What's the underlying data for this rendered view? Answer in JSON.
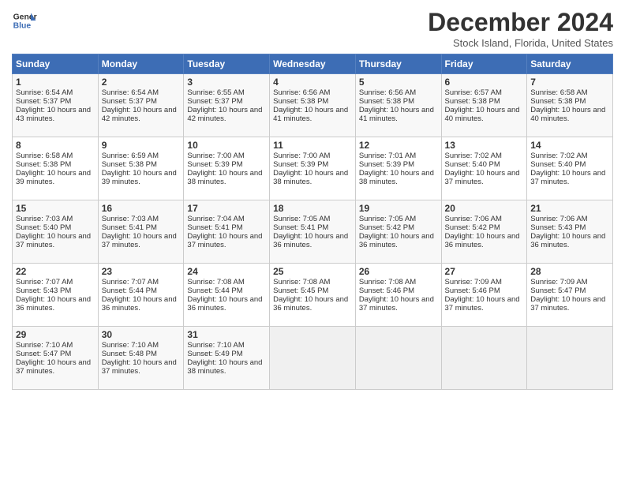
{
  "header": {
    "logo_line1": "General",
    "logo_line2": "Blue",
    "title": "December 2024",
    "subtitle": "Stock Island, Florida, United States"
  },
  "days_of_week": [
    "Sunday",
    "Monday",
    "Tuesday",
    "Wednesday",
    "Thursday",
    "Friday",
    "Saturday"
  ],
  "weeks": [
    [
      {
        "day": "1",
        "sunrise": "6:54 AM",
        "sunset": "5:37 PM",
        "daylight": "10 hours and 43 minutes."
      },
      {
        "day": "2",
        "sunrise": "6:54 AM",
        "sunset": "5:37 PM",
        "daylight": "10 hours and 42 minutes."
      },
      {
        "day": "3",
        "sunrise": "6:55 AM",
        "sunset": "5:37 PM",
        "daylight": "10 hours and 42 minutes."
      },
      {
        "day": "4",
        "sunrise": "6:56 AM",
        "sunset": "5:38 PM",
        "daylight": "10 hours and 41 minutes."
      },
      {
        "day": "5",
        "sunrise": "6:56 AM",
        "sunset": "5:38 PM",
        "daylight": "10 hours and 41 minutes."
      },
      {
        "day": "6",
        "sunrise": "6:57 AM",
        "sunset": "5:38 PM",
        "daylight": "10 hours and 40 minutes."
      },
      {
        "day": "7",
        "sunrise": "6:58 AM",
        "sunset": "5:38 PM",
        "daylight": "10 hours and 40 minutes."
      }
    ],
    [
      {
        "day": "8",
        "sunrise": "6:58 AM",
        "sunset": "5:38 PM",
        "daylight": "10 hours and 39 minutes."
      },
      {
        "day": "9",
        "sunrise": "6:59 AM",
        "sunset": "5:38 PM",
        "daylight": "10 hours and 39 minutes."
      },
      {
        "day": "10",
        "sunrise": "7:00 AM",
        "sunset": "5:39 PM",
        "daylight": "10 hours and 38 minutes."
      },
      {
        "day": "11",
        "sunrise": "7:00 AM",
        "sunset": "5:39 PM",
        "daylight": "10 hours and 38 minutes."
      },
      {
        "day": "12",
        "sunrise": "7:01 AM",
        "sunset": "5:39 PM",
        "daylight": "10 hours and 38 minutes."
      },
      {
        "day": "13",
        "sunrise": "7:02 AM",
        "sunset": "5:40 PM",
        "daylight": "10 hours and 37 minutes."
      },
      {
        "day": "14",
        "sunrise": "7:02 AM",
        "sunset": "5:40 PM",
        "daylight": "10 hours and 37 minutes."
      }
    ],
    [
      {
        "day": "15",
        "sunrise": "7:03 AM",
        "sunset": "5:40 PM",
        "daylight": "10 hours and 37 minutes."
      },
      {
        "day": "16",
        "sunrise": "7:03 AM",
        "sunset": "5:41 PM",
        "daylight": "10 hours and 37 minutes."
      },
      {
        "day": "17",
        "sunrise": "7:04 AM",
        "sunset": "5:41 PM",
        "daylight": "10 hours and 37 minutes."
      },
      {
        "day": "18",
        "sunrise": "7:05 AM",
        "sunset": "5:41 PM",
        "daylight": "10 hours and 36 minutes."
      },
      {
        "day": "19",
        "sunrise": "7:05 AM",
        "sunset": "5:42 PM",
        "daylight": "10 hours and 36 minutes."
      },
      {
        "day": "20",
        "sunrise": "7:06 AM",
        "sunset": "5:42 PM",
        "daylight": "10 hours and 36 minutes."
      },
      {
        "day": "21",
        "sunrise": "7:06 AM",
        "sunset": "5:43 PM",
        "daylight": "10 hours and 36 minutes."
      }
    ],
    [
      {
        "day": "22",
        "sunrise": "7:07 AM",
        "sunset": "5:43 PM",
        "daylight": "10 hours and 36 minutes."
      },
      {
        "day": "23",
        "sunrise": "7:07 AM",
        "sunset": "5:44 PM",
        "daylight": "10 hours and 36 minutes."
      },
      {
        "day": "24",
        "sunrise": "7:08 AM",
        "sunset": "5:44 PM",
        "daylight": "10 hours and 36 minutes."
      },
      {
        "day": "25",
        "sunrise": "7:08 AM",
        "sunset": "5:45 PM",
        "daylight": "10 hours and 36 minutes."
      },
      {
        "day": "26",
        "sunrise": "7:08 AM",
        "sunset": "5:46 PM",
        "daylight": "10 hours and 37 minutes."
      },
      {
        "day": "27",
        "sunrise": "7:09 AM",
        "sunset": "5:46 PM",
        "daylight": "10 hours and 37 minutes."
      },
      {
        "day": "28",
        "sunrise": "7:09 AM",
        "sunset": "5:47 PM",
        "daylight": "10 hours and 37 minutes."
      }
    ],
    [
      {
        "day": "29",
        "sunrise": "7:10 AM",
        "sunset": "5:47 PM",
        "daylight": "10 hours and 37 minutes."
      },
      {
        "day": "30",
        "sunrise": "7:10 AM",
        "sunset": "5:48 PM",
        "daylight": "10 hours and 37 minutes."
      },
      {
        "day": "31",
        "sunrise": "7:10 AM",
        "sunset": "5:49 PM",
        "daylight": "10 hours and 38 minutes."
      },
      null,
      null,
      null,
      null
    ]
  ]
}
